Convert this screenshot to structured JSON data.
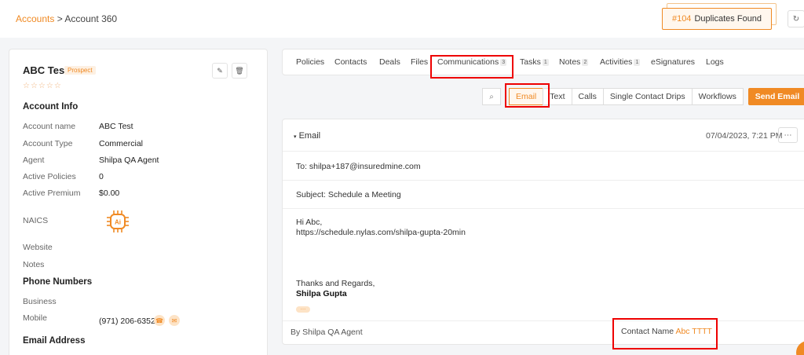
{
  "header": {
    "breadcrumb_root": "Accounts",
    "breadcrumb_sep": ">",
    "breadcrumb_current": "Account 360",
    "duplicates_number": "#104",
    "duplicates_label": "Duplicates Found"
  },
  "account": {
    "name": "ABC Test",
    "status_badge": "Prospect",
    "stars": "☆☆☆☆☆",
    "sections": {
      "info": "Account Info",
      "phones": "Phone Numbers",
      "email": "Email Address"
    },
    "fields": [
      {
        "label": "Account name",
        "value": "ABC Test"
      },
      {
        "label": "Account Type",
        "value": "Commercial"
      },
      {
        "label": "Agent",
        "value": "Shilpa QA Agent"
      },
      {
        "label": "Active Policies",
        "value": "0"
      },
      {
        "label": "Active Premium",
        "value": "$0.00"
      },
      {
        "label": "NAICS",
        "value": ""
      },
      {
        "label": "Website",
        "value": ""
      },
      {
        "label": "Notes",
        "value": ""
      }
    ],
    "phones": [
      {
        "label": "Business",
        "value": ""
      },
      {
        "label": "Mobile",
        "value": "(971) 206-6352"
      }
    ]
  },
  "tabs": [
    {
      "label": "Policies",
      "count": ""
    },
    {
      "label": "Contacts",
      "count": ""
    },
    {
      "label": "Deals",
      "count": ""
    },
    {
      "label": "Files",
      "count": ""
    },
    {
      "label": "Communications",
      "count": "3"
    },
    {
      "label": "Tasks",
      "count": "1"
    },
    {
      "label": "Notes",
      "count": "2"
    },
    {
      "label": "Activities",
      "count": "1"
    },
    {
      "label": "eSignatures",
      "count": ""
    },
    {
      "label": "Logs",
      "count": ""
    }
  ],
  "subtabs": [
    "Email",
    "Text",
    "Calls",
    "Single Contact Drips",
    "Workflows"
  ],
  "send_email_label": "Send Email",
  "email": {
    "section_title": "Email",
    "date": "07/04/2023, 7:21 PM",
    "to": "To: shilpa+187@insuredmine.com",
    "subject": "Subject: Schedule a Meeting",
    "greeting": "Hi Abc,",
    "link": "https://schedule.nylas.com/shilpa-gupta-20min",
    "signoff": "Thanks and Regards,",
    "signature": "Shilpa Gupta",
    "by_agent": "By Shilpa QA Agent",
    "contact_label": "Contact Name",
    "contact_value": "Abc TTTT"
  },
  "colors": {
    "accent": "#f08a24",
    "highlight_box": "#e00000"
  }
}
